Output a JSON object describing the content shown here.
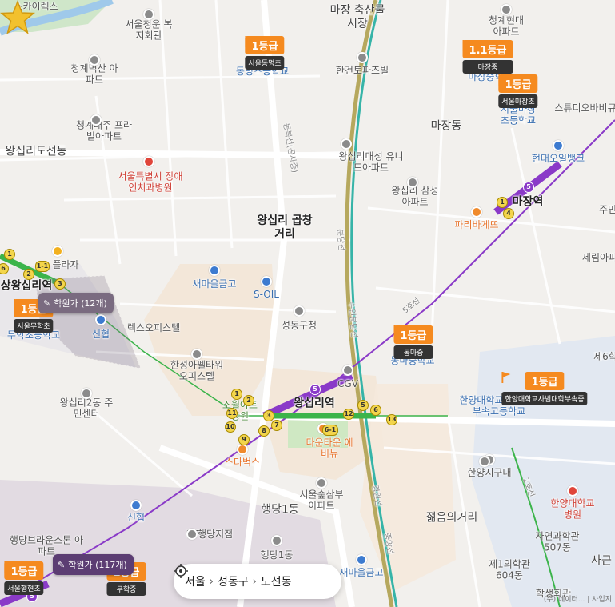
{
  "map": {
    "areas": [
      {
        "text": "마장 축산물시장",
        "cls": "big"
      },
      {
        "text": "마장동",
        "cls": "big"
      },
      {
        "text": "왕십리도선동",
        "cls": "big"
      },
      {
        "text": "왕십리 곱창거리",
        "cls": "bold"
      },
      {
        "text": "행당1동",
        "cls": "big"
      },
      {
        "text": "젊음의거리",
        "cls": "big"
      },
      {
        "text": "사근",
        "cls": "big"
      }
    ],
    "places": [
      {
        "text": "스카이렉스"
      },
      {
        "text": "서울청운 복지회관"
      },
      {
        "text": "청계벽산 아파트"
      },
      {
        "text": "청계대주 프라빌아파트"
      },
      {
        "text": "서울특별시 장애인치과병원",
        "cls": "red"
      },
      {
        "text": "청계현대 아파트"
      },
      {
        "text": "한건토파즈빌"
      },
      {
        "text": "동명초등학교",
        "cls": "blue"
      },
      {
        "text": "마장중학교",
        "cls": "blue"
      },
      {
        "text": "서울마장 초등학교",
        "cls": "blue"
      },
      {
        "text": "스튜디오바비큐"
      },
      {
        "text": "왕십리대성 유니드아파트"
      },
      {
        "text": "왕십리 삼성아파트"
      },
      {
        "text": "현대오일뱅크",
        "cls": "blue"
      },
      {
        "text": "파리바게뜨",
        "cls": "orange"
      },
      {
        "text": "마장역",
        "cls": "bold"
      },
      {
        "text": "주민",
        "cls": ""
      },
      {
        "text": "세림아파"
      },
      {
        "text": "새마을금고",
        "cls": "blue"
      },
      {
        "text": "S-OIL",
        "cls": "blue"
      },
      {
        "text": "성동구청"
      },
      {
        "text": "플라자"
      },
      {
        "text": "상왕십리역",
        "cls": "bold"
      },
      {
        "text": "무학초등학교",
        "cls": "blue"
      },
      {
        "text": "신협",
        "cls": "blue"
      },
      {
        "text": "렉스오피스텔"
      },
      {
        "text": "한성아펠타워 오피스텔"
      },
      {
        "text": "왕십리2동 주민센터"
      },
      {
        "text": "CGV"
      },
      {
        "text": "왕십리역",
        "cls": "bold"
      },
      {
        "text": "동마중학교",
        "cls": "blue"
      },
      {
        "text": "제6학"
      },
      {
        "text": "한양대학교사범대학 부속고등학교",
        "cls": "blue"
      },
      {
        "text": "한양지구대"
      },
      {
        "text": "한양대학교 병원",
        "cls": "red"
      },
      {
        "text": "자연과학관 507동"
      },
      {
        "text": "제1의학관 604동"
      },
      {
        "text": "학생회관"
      },
      {
        "text": "다운타운 에비뉴",
        "cls": "orange"
      },
      {
        "text": "스타벅스",
        "cls": "orange"
      },
      {
        "text": "소월아트 공원",
        "cls": "green"
      },
      {
        "text": "서울숲삼부 아파트"
      },
      {
        "text": "신협",
        "cls": "blue"
      },
      {
        "text": "KT행당지점"
      },
      {
        "text": "행당1동"
      },
      {
        "text": "행당브라운스톤 아파트"
      },
      {
        "text": "새마을금고",
        "cls": "blue"
      }
    ],
    "roads": [
      {
        "text": "동북선(공사중)"
      },
      {
        "text": "분당선"
      },
      {
        "text": "수인분당선"
      },
      {
        "text": "5호선"
      },
      {
        "text": "2호선"
      },
      {
        "text": "경원선"
      },
      {
        "text": "중앙선"
      }
    ]
  },
  "badges": [
    {
      "grade": "1등급",
      "school": "서울동명초"
    },
    {
      "grade": "1.1등급",
      "school": "마장중"
    },
    {
      "grade": "1등급",
      "school": "서울마장초"
    },
    {
      "grade": "1등급",
      "school": "서울무학초"
    },
    {
      "grade": "1등급",
      "school": "동마중"
    },
    {
      "grade": "1등급",
      "school": "한양대학교사범대학부속중"
    },
    {
      "grade": "1등급",
      "school": "서울행현초"
    },
    {
      "grade": "1등급",
      "school": "무학중"
    }
  ],
  "academies": [
    {
      "label": "학원가 (12개)"
    },
    {
      "label": "학원가 (117개)"
    }
  ],
  "stations": [
    {
      "n": "1"
    },
    {
      "n": "2"
    },
    {
      "n": "5"
    },
    {
      "n": "6"
    },
    {
      "n": "1-1"
    },
    {
      "n": "3"
    },
    {
      "n": "1"
    },
    {
      "n": "5"
    },
    {
      "n": "4"
    },
    {
      "n": "1"
    },
    {
      "n": "2"
    },
    {
      "n": "11"
    },
    {
      "n": "3"
    },
    {
      "n": "7"
    },
    {
      "n": "8"
    },
    {
      "n": "9"
    },
    {
      "n": "10"
    },
    {
      "n": "5"
    },
    {
      "n": "12"
    },
    {
      "n": "13"
    },
    {
      "n": "6"
    },
    {
      "n": "6-1"
    },
    {
      "n": "5"
    }
  ],
  "breadcrumb": {
    "parts": [
      "서울",
      "성동구",
      "도선동"
    ]
  },
  "copyright": "(주) 데이터... | 사업지",
  "colors": {
    "line5": "#8a3ac8",
    "line2": "#3cb44b",
    "badge": "#f58a1f"
  }
}
